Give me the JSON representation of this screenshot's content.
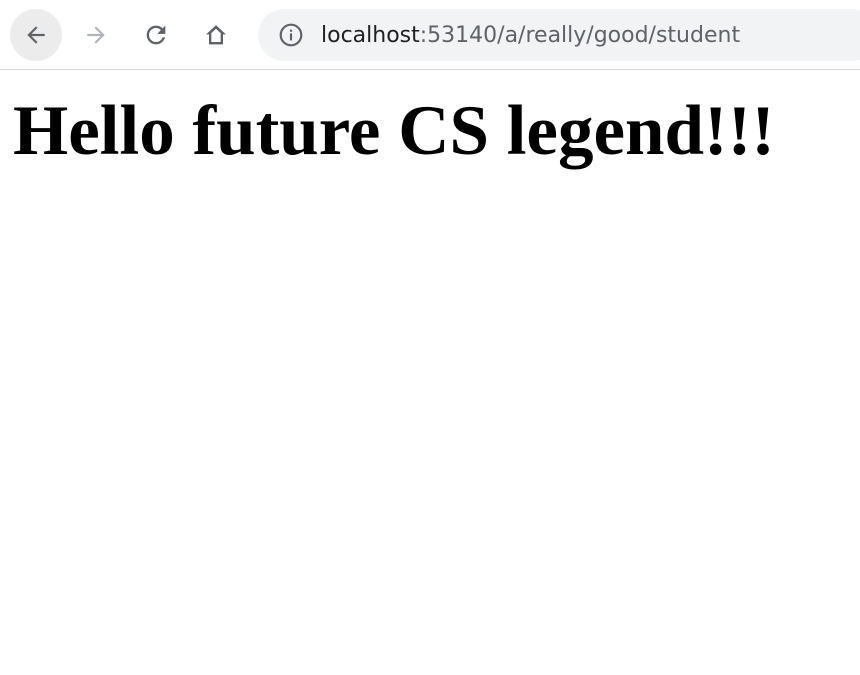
{
  "toolbar": {
    "icons": {
      "back": "arrow-left-icon",
      "forward": "arrow-right-icon",
      "reload": "reload-icon",
      "home": "home-icon",
      "info": "info-icon"
    },
    "address": {
      "host": "localhost",
      "rest": ":53140/a/really/good/student"
    }
  },
  "page": {
    "heading": "Hello future CS legend!!!"
  },
  "colors": {
    "toolbar_icon": "#5f6368",
    "disabled_icon": "#b0b3b8",
    "omnibox_bg": "#f1f3f4",
    "page_bg": "#ffffff",
    "heading": "#000000"
  }
}
